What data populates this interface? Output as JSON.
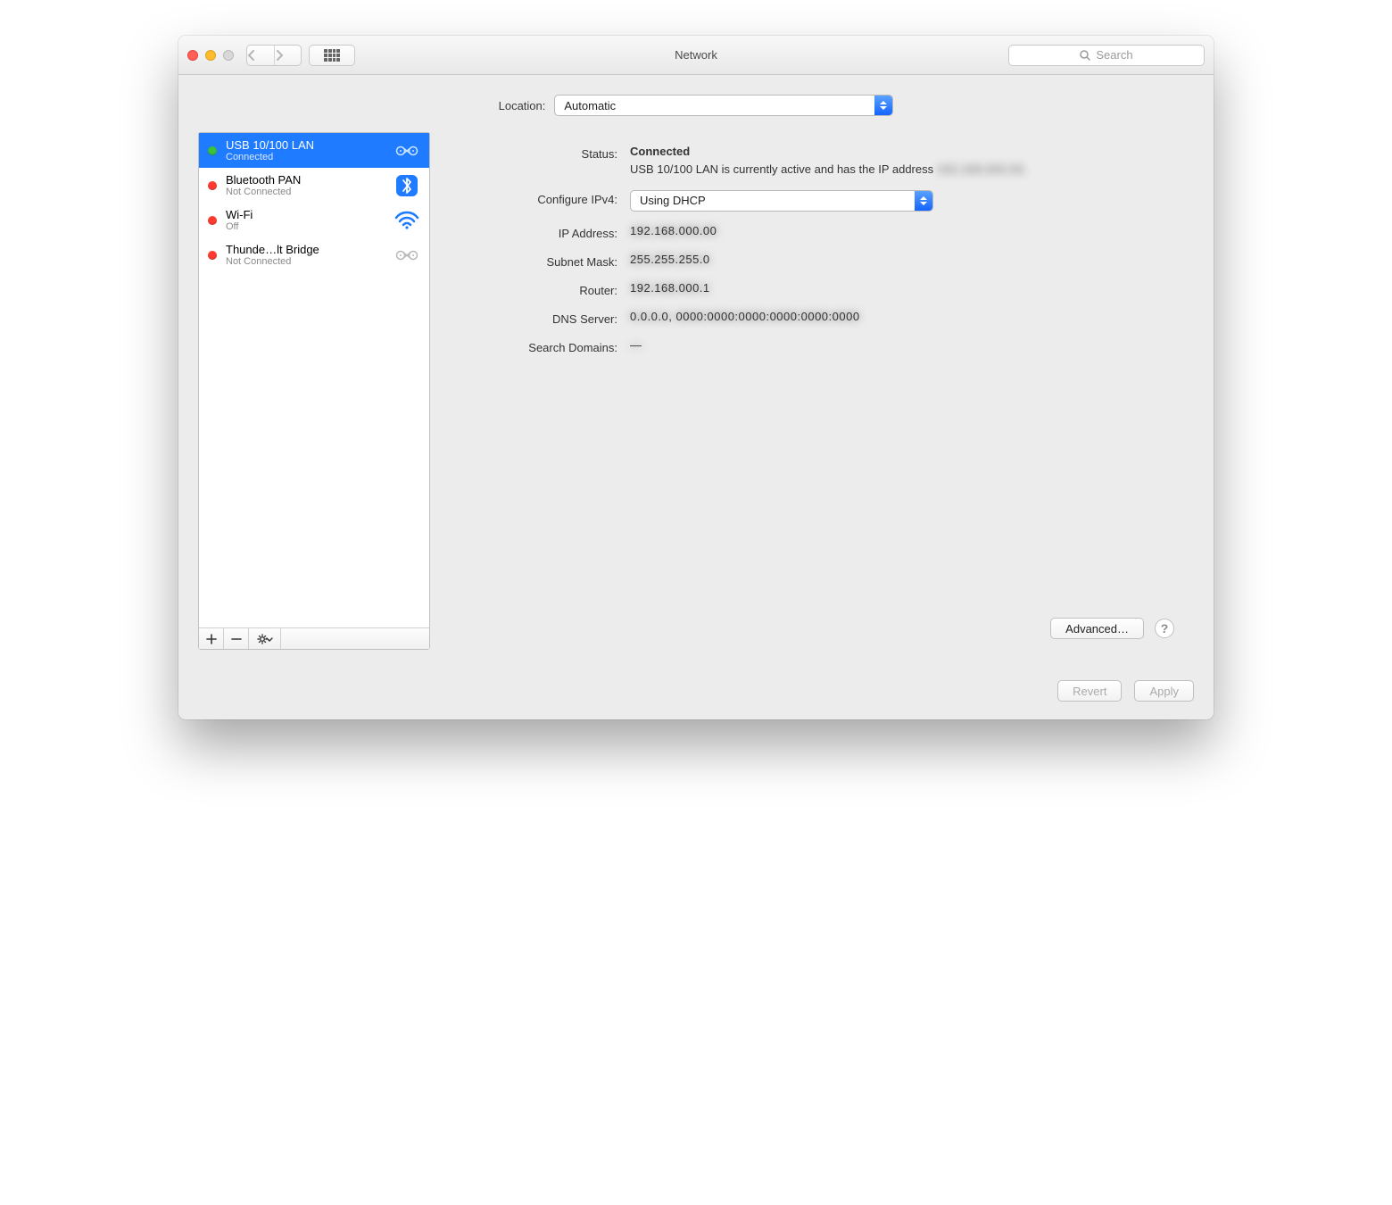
{
  "window": {
    "title": "Network"
  },
  "toolbar": {
    "search_placeholder": "Search"
  },
  "location": {
    "label": "Location:",
    "value": "Automatic"
  },
  "sidebar": {
    "items": [
      {
        "name": "USB 10/100 LAN",
        "status": "Connected",
        "status_color": "green",
        "icon": "ethernet",
        "selected": true
      },
      {
        "name": "Bluetooth PAN",
        "status": "Not Connected",
        "status_color": "red",
        "icon": "bluetooth",
        "selected": false
      },
      {
        "name": "Wi-Fi",
        "status": "Off",
        "status_color": "red",
        "icon": "wifi",
        "selected": false
      },
      {
        "name": "Thunde…lt Bridge",
        "status": "Not Connected",
        "status_color": "red",
        "icon": "ethernet-gray",
        "selected": false
      }
    ]
  },
  "details": {
    "status_label": "Status:",
    "status_value": "Connected",
    "status_desc_prefix": "USB 10/100 LAN is currently active and has the IP address ",
    "status_desc_ip": "192.168.000.00.",
    "configure_label": "Configure IPv4:",
    "configure_value": "Using DHCP",
    "ip_label": "IP Address:",
    "ip_value": "192.168.000.00",
    "subnet_label": "Subnet Mask:",
    "subnet_value": "255.255.255.0",
    "router_label": "Router:",
    "router_value": "192.168.000.1",
    "dns_label": "DNS Server:",
    "dns_value": "0.0.0.0, 0000:0000:0000:0000:0000:0000",
    "search_domains_label": "Search Domains:",
    "search_domains_value": "—",
    "advanced_button": "Advanced…"
  },
  "footer": {
    "revert": "Revert",
    "apply": "Apply"
  }
}
